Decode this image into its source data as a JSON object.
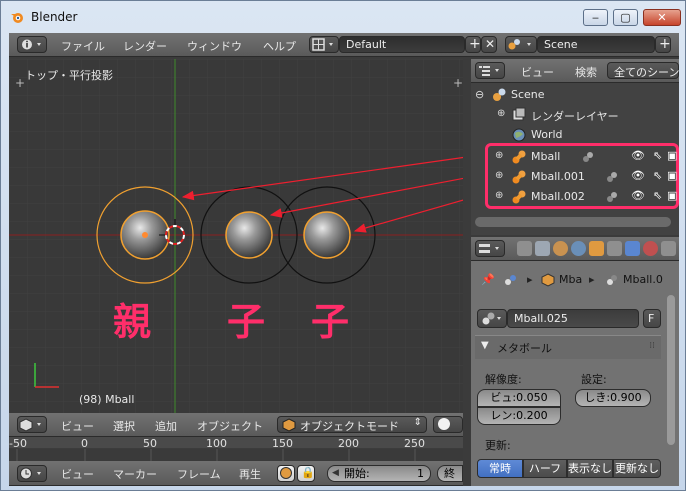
{
  "window": {
    "title": "Blender",
    "buttons": {
      "minimize": "‒",
      "maximize": "▢",
      "close": "✕"
    }
  },
  "top_header": {
    "menus": [
      "ファイル",
      "レンダー",
      "ウィンドウ",
      "ヘルプ"
    ],
    "layout": "Default",
    "scene": "Scene"
  },
  "viewport": {
    "view_label": "トップ・平行投影",
    "status": "(98) Mball",
    "annotations": [
      "親",
      "子",
      "子"
    ]
  },
  "outliner": {
    "header": {
      "view": "ビュー",
      "search": "検索",
      "filter": "全てのシーン"
    },
    "scene": "Scene",
    "render_layers": "レンダーレイヤー",
    "world": "World",
    "objects": [
      "Mball",
      "Mball.001",
      "Mball.002"
    ]
  },
  "properties": {
    "breadcrumb": {
      "mesh": "Mba",
      "data": "Mball.0"
    },
    "datablock": "Mball.025",
    "datablock_flag": "F",
    "panel_title": "メタボール",
    "resolution_label": "解像度:",
    "settings_label": "設定:",
    "view_res": "ビュ:0.050",
    "render_res": "レン:0.200",
    "threshold": "しき:0.900",
    "update_label": "更新:",
    "update_modes": [
      "常時",
      "ハーフ",
      "表示なし",
      "更新なし"
    ],
    "active_update": "常時"
  },
  "viewport_header": {
    "menus": [
      "ビュー",
      "選択",
      "追加",
      "オブジェクト"
    ],
    "mode": "オブジェクトモード"
  },
  "timeline": {
    "ticks": [
      "-50",
      "0",
      "50",
      "100",
      "150",
      "200",
      "250"
    ]
  },
  "timeline_header": {
    "menus": [
      "ビュー",
      "マーカー",
      "フレーム",
      "再生"
    ],
    "start_label": "開始:",
    "start_value": "1",
    "end_label": "終"
  },
  "colors": {
    "accent_highlight": "#ff2e6a",
    "selection_orange": "#f0a030",
    "active_blue": "#4e7ccc"
  }
}
